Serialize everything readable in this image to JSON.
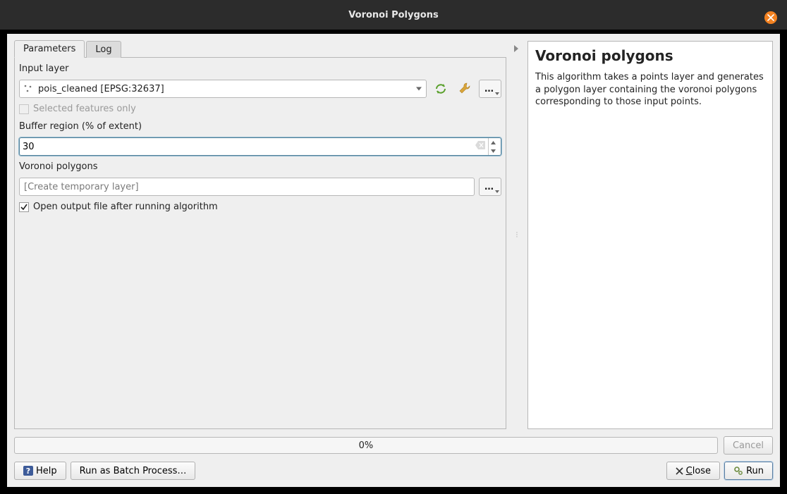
{
  "titlebar": {
    "title": "Voronoi Polygons"
  },
  "tabs": {
    "parameters": "Parameters",
    "log": "Log"
  },
  "fields": {
    "input_layer_label": "Input layer",
    "input_layer_value": "pois_cleaned [EPSG:32637]",
    "selected_only_label": "Selected features only",
    "buffer_label": "Buffer region (% of extent)",
    "buffer_value": "30",
    "voronoi_label": "Voronoi polygons",
    "output_placeholder": "[Create temporary layer]",
    "open_output_label": "Open output file after running algorithm"
  },
  "help": {
    "title": "Voronoi polygons",
    "body": "This algorithm takes a points layer and generates a polygon layer containing the voronoi polygons corresponding to those input points."
  },
  "progress": {
    "text": "0%"
  },
  "buttons": {
    "cancel": "Cancel",
    "help": "Help",
    "batch": "Run as Batch Process…",
    "close": "lose",
    "close_prefix": "C",
    "run": "Run"
  }
}
